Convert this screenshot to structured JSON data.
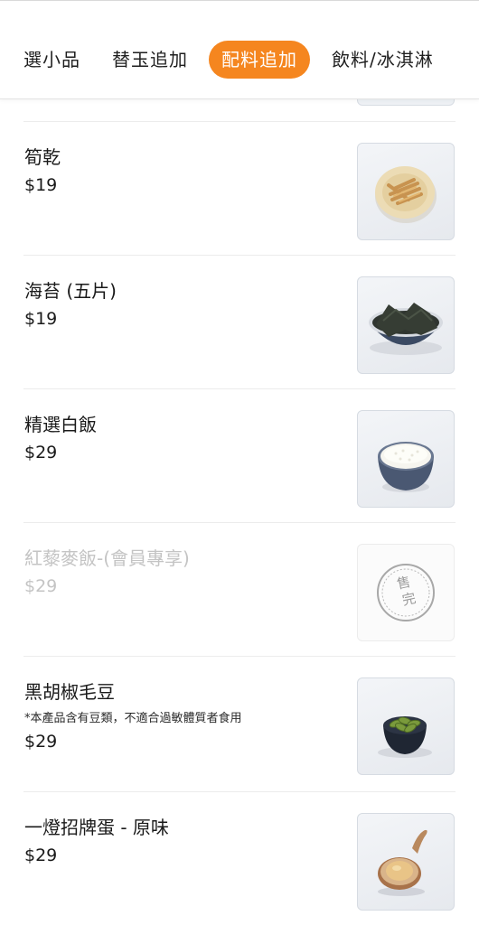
{
  "tabs": [
    {
      "label": "選小品",
      "active": false
    },
    {
      "label": "替玉追加",
      "active": false
    },
    {
      "label": "配料追加",
      "active": true
    },
    {
      "label": "飲料/冰淇淋",
      "active": false
    }
  ],
  "colors": {
    "accent": "#f5861f",
    "text": "#1a1a1a",
    "disabled": "#c4c4c4",
    "divider": "#ececec"
  },
  "items": [
    {
      "name": "筍乾",
      "price": "$19",
      "image": "bamboo-shoots-plate-image"
    },
    {
      "name": "海苔 (五片)",
      "price": "$19",
      "image": "seaweed-bowl-image"
    },
    {
      "name": "精選白飯",
      "price": "$29",
      "image": "white-rice-bowl-image"
    },
    {
      "name": "紅藜麥飯-(會員專享)",
      "price": "$29",
      "image": "sold-out-stamp-image",
      "sold_out": true,
      "sold_out_label": "售完"
    },
    {
      "name": "黑胡椒毛豆",
      "note": "*本產品含有豆類，不適合過敏體質者食用",
      "price": "$29",
      "image": "edamame-bowl-image"
    },
    {
      "name": "一燈招牌蛋 - 原味",
      "price": "$29",
      "image": "egg-spoon-image"
    }
  ]
}
